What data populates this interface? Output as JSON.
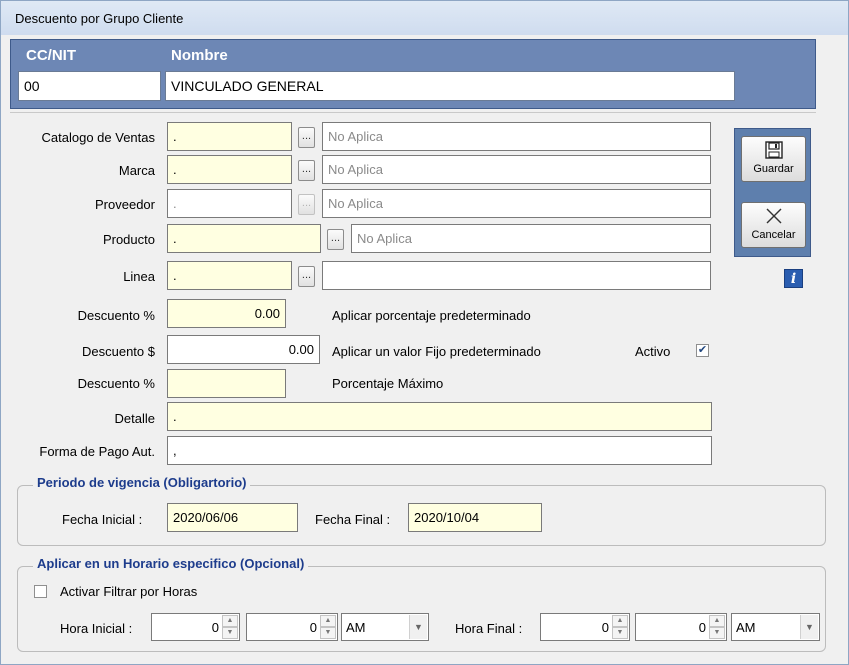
{
  "window": {
    "title": "Descuento por Grupo Cliente"
  },
  "client": {
    "ccnit_header": "CC/NIT",
    "nombre_header": "Nombre",
    "ccnit_value": "00",
    "nombre_value": "VINCULADO GENERAL"
  },
  "form": {
    "catalogo": {
      "label": "Catalogo de Ventas",
      "code": ".",
      "desc": "No Aplica"
    },
    "marca": {
      "label": "Marca",
      "code": ".",
      "desc": "No Aplica"
    },
    "proveedor": {
      "label": "Proveedor",
      "code": ".",
      "desc": "No Aplica"
    },
    "producto": {
      "label": "Producto",
      "code": ".",
      "desc": "No Aplica"
    },
    "linea": {
      "label": "Linea",
      "code": ".",
      "desc": ""
    },
    "descuento_pct": {
      "label": "Descuento %",
      "value": "0.00",
      "note": "Aplicar porcentaje predeterminado"
    },
    "descuento_valor": {
      "label": "Descuento $",
      "value": "0.00",
      "note": "Aplicar un valor Fijo predeterminado"
    },
    "descuento_max": {
      "label": "Descuento %",
      "value": "",
      "note": "Porcentaje Máximo"
    },
    "detalle": {
      "label": "Detalle",
      "value": "."
    },
    "forma_pago": {
      "label": "Forma de Pago Aut.",
      "value": ","
    },
    "activo": {
      "label": "Activo",
      "checked": true
    },
    "dots_label": "..."
  },
  "toolbar": {
    "save_label": "Guardar",
    "cancel_label": "Cancelar"
  },
  "vigencia": {
    "title": "Periodo de vigencia  (Obligartorio)",
    "fecha_inicial_label": "Fecha Inicial :",
    "fecha_inicial": "2020/06/06",
    "fecha_final_label": "Fecha Final :",
    "fecha_final": "2020/10/04"
  },
  "horario": {
    "title": "Aplicar en un Horario  especifico  (Opcional)",
    "filter_label": "Activar Filtrar por Horas",
    "filter_checked": false,
    "hora_inicial_label": "Hora Inicial :",
    "hora_inicial_h": "0",
    "hora_inicial_m": "0",
    "hora_inicial_ampm": "AM",
    "hora_final_label": "Hora Final :",
    "hora_final_h": "0",
    "hora_final_m": "0",
    "hora_final_ampm": "AM"
  }
}
